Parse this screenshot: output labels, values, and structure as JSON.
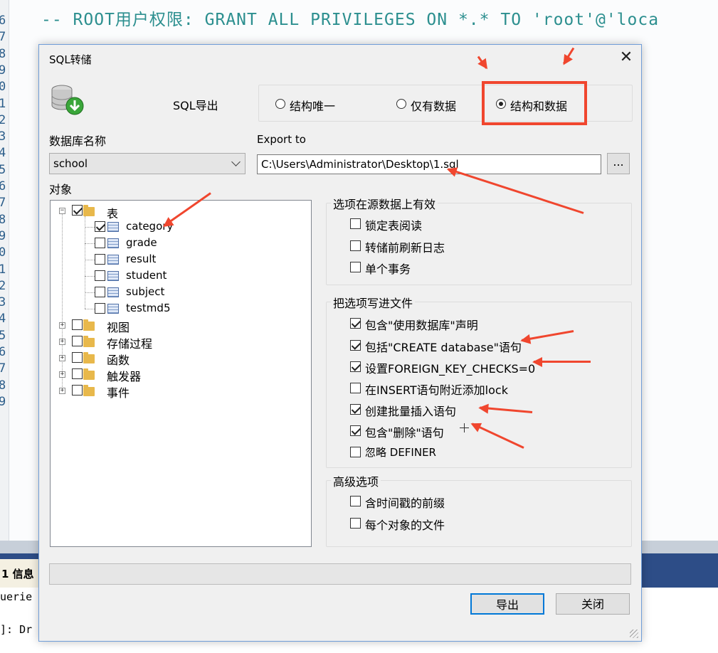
{
  "background": {
    "code_line": "-- ROOT用户权限: GRANT ALL PRIVILEGES ON *.* TO 'root'@'loca",
    "line_numbers": [
      "6",
      "7",
      "8",
      "9",
      "0",
      "1",
      "2",
      "3",
      "4",
      "5",
      "6",
      "7",
      "8",
      "9",
      "0",
      "1",
      "2",
      "3",
      "4",
      "5",
      "6",
      "7",
      "8",
      "9"
    ],
    "info_tab": "1 信息",
    "result_lines": [
      "uerie",
      "]: Dr"
    ]
  },
  "dialog": {
    "title": "SQL转储",
    "close_glyph": "✕",
    "export_label": "SQL导出",
    "export_mode": {
      "options": [
        "结构唯一",
        "仅有数据",
        "结构和数据"
      ],
      "selected": "结构和数据"
    },
    "db_name_label": "数据库名称",
    "db_selected": "school",
    "export_to_label": "Export to",
    "export_path": "C:\\Users\\Administrator\\Desktop\\1.sql",
    "browse_label": "...",
    "objects_label": "对象",
    "tree": {
      "tables_label": "表",
      "tables": [
        {
          "name": "category",
          "checked": true
        },
        {
          "name": "grade",
          "checked": false
        },
        {
          "name": "result",
          "checked": false
        },
        {
          "name": "student",
          "checked": false
        },
        {
          "name": "subject",
          "checked": false
        },
        {
          "name": "testmd5",
          "checked": false
        }
      ],
      "groups": [
        "视图",
        "存储过程",
        "函数",
        "触发器",
        "事件"
      ]
    },
    "source_group": {
      "title": "选项在源数据上有效",
      "options": [
        {
          "label": "锁定表阅读",
          "checked": false
        },
        {
          "label": "转储前刷新日志",
          "checked": false
        },
        {
          "label": "单个事务",
          "checked": false
        }
      ]
    },
    "file_group": {
      "title": "把选项写进文件",
      "options": [
        {
          "label": "包含\"使用数据库\"声明",
          "checked": true
        },
        {
          "label": "包括\"CREATE database\"语句",
          "checked": true
        },
        {
          "label": "设置FOREIGN_KEY_CHECKS=0",
          "checked": true
        },
        {
          "label": "在INSERT语句附近添加lock",
          "checked": false
        },
        {
          "label": "创建批量插入语句",
          "checked": true
        },
        {
          "label": "包含\"删除\"语句",
          "checked": true
        },
        {
          "label": "忽略 DEFINER",
          "checked": false
        }
      ]
    },
    "advanced_group": {
      "title": "高级选项",
      "options": [
        {
          "label": "含时间戳的前缀",
          "checked": false
        },
        {
          "label": "每个对象的文件",
          "checked": false
        }
      ]
    },
    "export_button": "导出",
    "close_button": "关闭"
  },
  "colors": {
    "annotation_red": "#f0462e",
    "accent_blue": "#0078d7"
  }
}
